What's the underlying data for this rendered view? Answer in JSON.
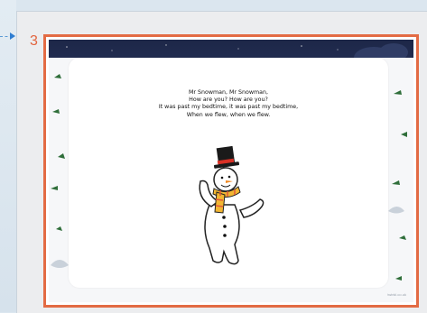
{
  "slide": {
    "number": "3",
    "poem_lines": [
      "Mr Snowman, Mr Snowman,",
      "How are you? How are you?",
      "It was past my bedtime, it was past my bedtime,",
      "When we flew, when we flew."
    ],
    "credit": "twinkl.co.uk"
  },
  "colors": {
    "frame": "#e36b44",
    "sky": "#1d2748",
    "scarf": "#f2b632",
    "accent_blue": "#2f7dd1"
  }
}
